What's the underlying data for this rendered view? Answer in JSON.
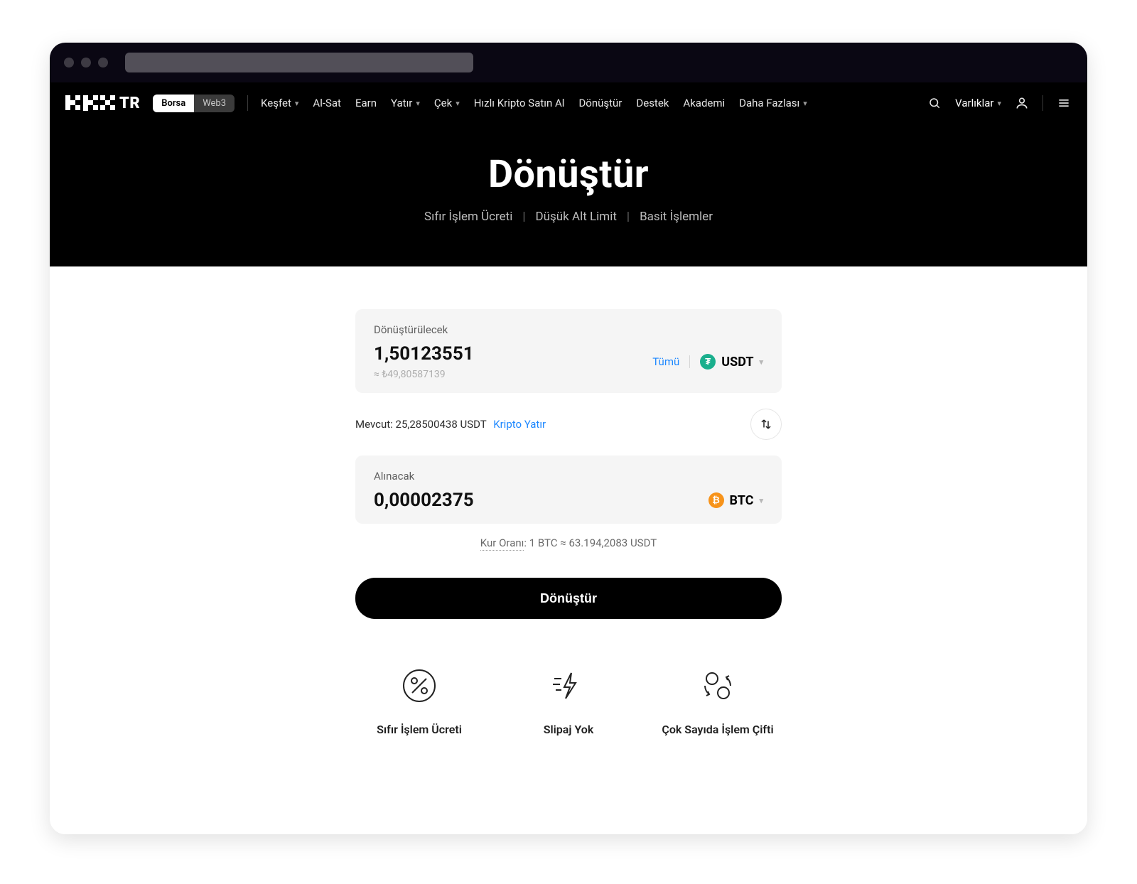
{
  "nav": {
    "seg_borsa": "Borsa",
    "seg_web3": "Web3",
    "kesfet": "Keşfet",
    "alsat": "Al-Sat",
    "earn": "Earn",
    "yatir": "Yatır",
    "cek": "Çek",
    "hizli": "Hızlı Kripto Satın Al",
    "donustur": "Dönüştür",
    "destek": "Destek",
    "akademi": "Akademi",
    "daha": "Daha Fazlası",
    "varliklar": "Varlıklar"
  },
  "hero": {
    "title": "Dönüştür",
    "sub1": "Sıfır İşlem Ücreti",
    "sub2": "Düşük Alt Limit",
    "sub3": "Basit İşlemler"
  },
  "from": {
    "label": "Dönüştürülecek",
    "amount": "1,50123551",
    "approx": "≈ ₺49,80587139",
    "all": "Tümü",
    "token": "USDT"
  },
  "balance": {
    "prefix": "Mevcut:",
    "value": "25,28500438 USDT",
    "deposit": "Kripto Yatır"
  },
  "to": {
    "label": "Alınacak",
    "amount": "0,00002375",
    "token": "BTC"
  },
  "rate": {
    "label": "Kur Oranı",
    "value": ": 1 BTC ≈ 63.194,2083 USDT"
  },
  "cta": "Dönüştür",
  "features": {
    "f1": "Sıfır İşlem Ücreti",
    "f2": "Slipaj Yok",
    "f3": "Çok Sayıda İşlem Çifti"
  }
}
